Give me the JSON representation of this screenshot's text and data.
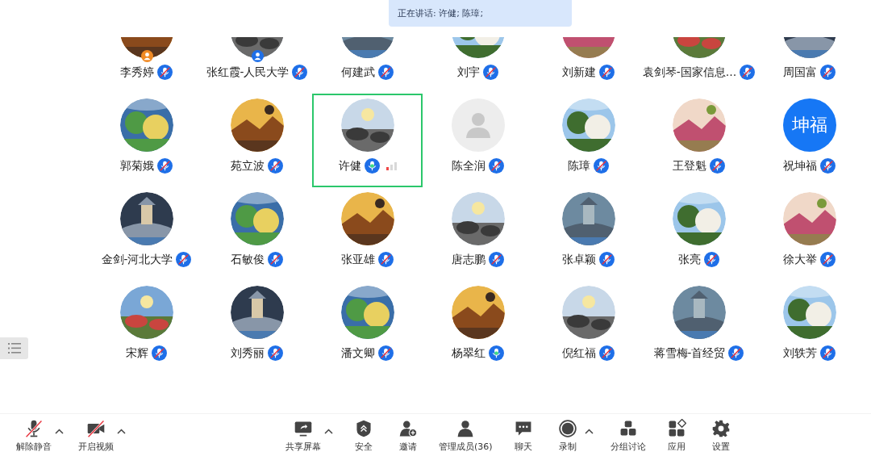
{
  "speaker_banner": {
    "text": "正在讲话: 许健; 陈璋;"
  },
  "participants": [
    {
      "name": "李秀婷",
      "kind": "picture",
      "muted": true,
      "host": true
    },
    {
      "name": "张红霞-人民大学",
      "kind": "picture",
      "muted": true,
      "cohost": true
    },
    {
      "name": "何建武",
      "kind": "picture",
      "muted": true
    },
    {
      "name": "刘宇",
      "kind": "picture",
      "muted": true
    },
    {
      "name": "刘新建",
      "kind": "picture",
      "muted": true
    },
    {
      "name": "袁剑琴-国家信息…",
      "kind": "picture",
      "muted": true
    },
    {
      "name": "周国富",
      "kind": "picture",
      "muted": true
    },
    {
      "name": "郭菊娥",
      "kind": "picture",
      "muted": true
    },
    {
      "name": "苑立波",
      "kind": "picture",
      "muted": true
    },
    {
      "name": "许健",
      "kind": "picture",
      "muted": false,
      "highlighted": true,
      "level": 0.33
    },
    {
      "name": "陈全润",
      "kind": "default",
      "muted": true
    },
    {
      "name": "陈璋",
      "kind": "picture",
      "muted": true
    },
    {
      "name": "王登魁",
      "kind": "picture",
      "muted": true
    },
    {
      "name": "祝坤福",
      "kind": "text",
      "avatar_text": "坤福",
      "muted": true
    },
    {
      "name": "金剑-河北大学",
      "kind": "picture",
      "muted": true
    },
    {
      "name": "石敏俊",
      "kind": "picture",
      "muted": true
    },
    {
      "name": "张亚雄",
      "kind": "picture",
      "muted": true
    },
    {
      "name": "唐志鹏",
      "kind": "picture",
      "muted": true
    },
    {
      "name": "张卓颖",
      "kind": "picture",
      "muted": true
    },
    {
      "name": "张亮",
      "kind": "picture",
      "muted": true
    },
    {
      "name": "徐大举",
      "kind": "picture",
      "muted": true
    },
    {
      "name": "宋辉",
      "kind": "picture",
      "muted": true
    },
    {
      "name": "刘秀丽",
      "kind": "picture",
      "muted": true
    },
    {
      "name": "潘文卿",
      "kind": "picture",
      "muted": true
    },
    {
      "name": "杨翠红",
      "kind": "picture",
      "muted": false
    },
    {
      "name": "倪红福",
      "kind": "picture",
      "muted": true
    },
    {
      "name": "蒋雪梅-首经贸",
      "kind": "picture",
      "muted": true
    },
    {
      "name": "刘轶芳",
      "kind": "picture",
      "muted": true
    }
  ],
  "toolbar": {
    "left": [
      {
        "kind": "mic",
        "label": "解除静音",
        "caret": true,
        "off": true
      },
      {
        "kind": "video",
        "label": "开启视频",
        "caret": true,
        "off": true
      }
    ],
    "center": [
      {
        "kind": "share",
        "label": "共享屏幕",
        "caret": true
      },
      {
        "kind": "security",
        "label": "安全",
        "caret": false
      },
      {
        "kind": "invite",
        "label": "邀请",
        "caret": false
      },
      {
        "kind": "members",
        "label": "管理成员(36)",
        "caret": false
      },
      {
        "kind": "chat",
        "label": "聊天",
        "caret": false
      },
      {
        "kind": "record",
        "label": "录制",
        "caret": true
      },
      {
        "kind": "breakout",
        "label": "分组讨论",
        "caret": false
      },
      {
        "kind": "apps",
        "label": "应用",
        "caret": false
      },
      {
        "kind": "settings",
        "label": "设置",
        "caret": false
      }
    ]
  }
}
